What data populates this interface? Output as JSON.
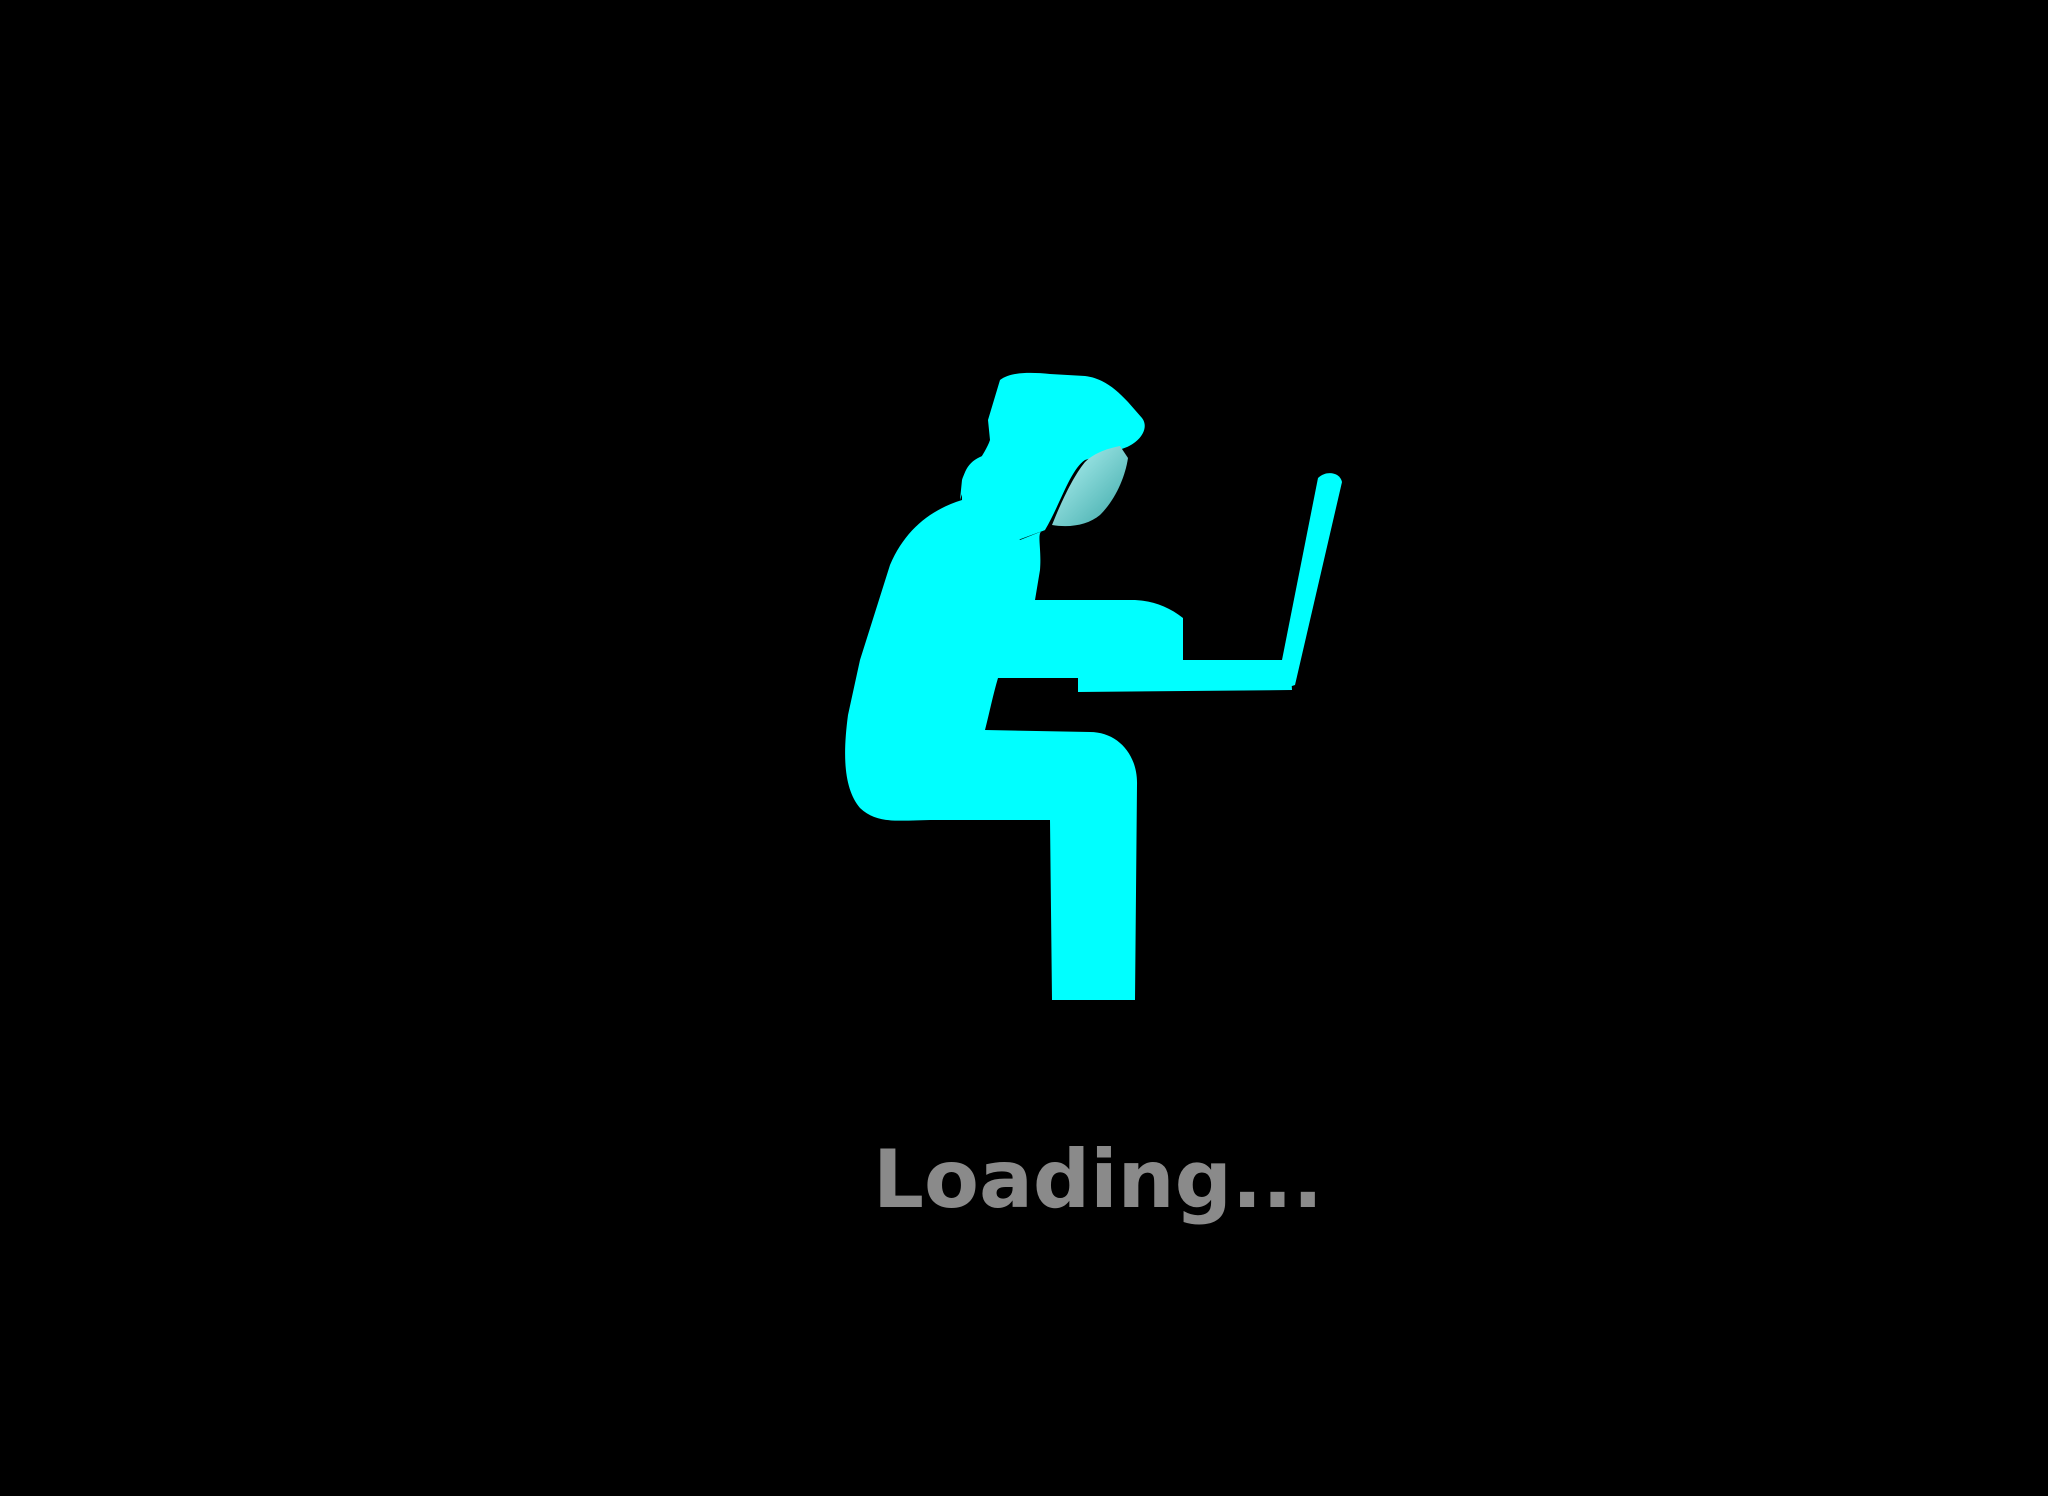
{
  "loading": {
    "text": "Loading..."
  },
  "illustration": {
    "icon": "person-with-laptop-icon",
    "color": "#00ffff",
    "shade_color": "#5cd6d6"
  },
  "colors": {
    "background": "#000000",
    "text": "#8a8a8a"
  }
}
